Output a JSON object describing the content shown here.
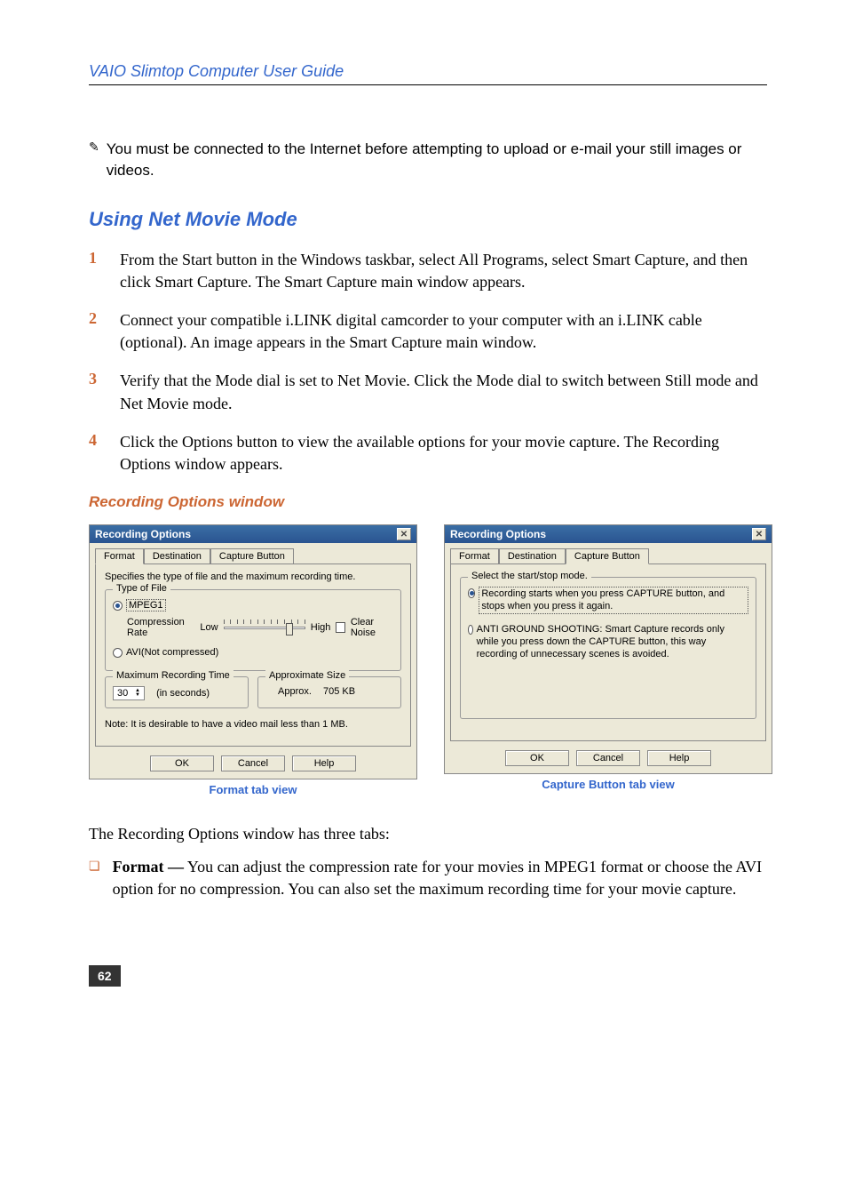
{
  "header": "VAIO Slimtop Computer User Guide",
  "note": {
    "icon": "✎",
    "text": "You must be connected to the Internet before attempting to upload or e-mail your still images or videos."
  },
  "sectionTitle": "Using Net Movie Mode",
  "steps": [
    "From the Start button in the Windows taskbar, select All Programs, select Smart Capture, and then click Smart Capture. The Smart Capture main window appears.",
    "Connect your compatible i.LINK digital camcorder to your computer with an i.LINK cable (optional). An image appears in the Smart Capture main window.",
    "Verify that the Mode dial is set to Net Movie. Click the Mode dial to switch between Still mode and Net Movie mode.",
    "Click the Options button to view the available options for your movie capture. The Recording Options window appears."
  ],
  "subsectionTitle": "Recording Options window",
  "dialog1": {
    "title": "Recording Options",
    "tabs": [
      "Format",
      "Destination",
      "Capture Button"
    ],
    "activeTab": 0,
    "desc": "Specifies the type of file and the maximum recording time.",
    "typeOfFile": {
      "label": "Type of File",
      "mpeg": "MPEG1",
      "compRate": "Compression Rate",
      "low": "Low",
      "high": "High",
      "clearNoise": "Clear Noise",
      "avi": "AVI(Not compressed)"
    },
    "maxRec": {
      "label": "Maximum Recording Time",
      "value": "30",
      "unit": "(in seconds)"
    },
    "approxSize": {
      "label": "Approximate Size",
      "approx": "Approx.",
      "value": "705 KB"
    },
    "noteLine": "Note: It is desirable to have a video mail less than 1 MB.",
    "buttons": {
      "ok": "OK",
      "cancel": "Cancel",
      "help": "Help"
    },
    "caption": "Format tab view"
  },
  "dialog2": {
    "title": "Recording Options",
    "tabs": [
      "Format",
      "Destination",
      "Capture Button"
    ],
    "activeTab": 2,
    "selectMode": "Select the start/stop mode.",
    "opt1": "Recording starts when you press CAPTURE button, and stops when you press it again.",
    "opt2": "ANTI GROUND SHOOTING: Smart Capture records only while you press down the CAPTURE button, this way recording of unnecessary scenes is avoided.",
    "buttons": {
      "ok": "OK",
      "cancel": "Cancel",
      "help": "Help"
    },
    "caption": "Capture Button tab view"
  },
  "bodyText": "The Recording Options window has three tabs:",
  "bullet": {
    "label": "Format —",
    "text": " You can adjust the compression rate for your movies in MPEG1 format or choose the AVI option for no compression. You can also set the maximum recording time for your movie capture."
  },
  "pageNum": "62"
}
